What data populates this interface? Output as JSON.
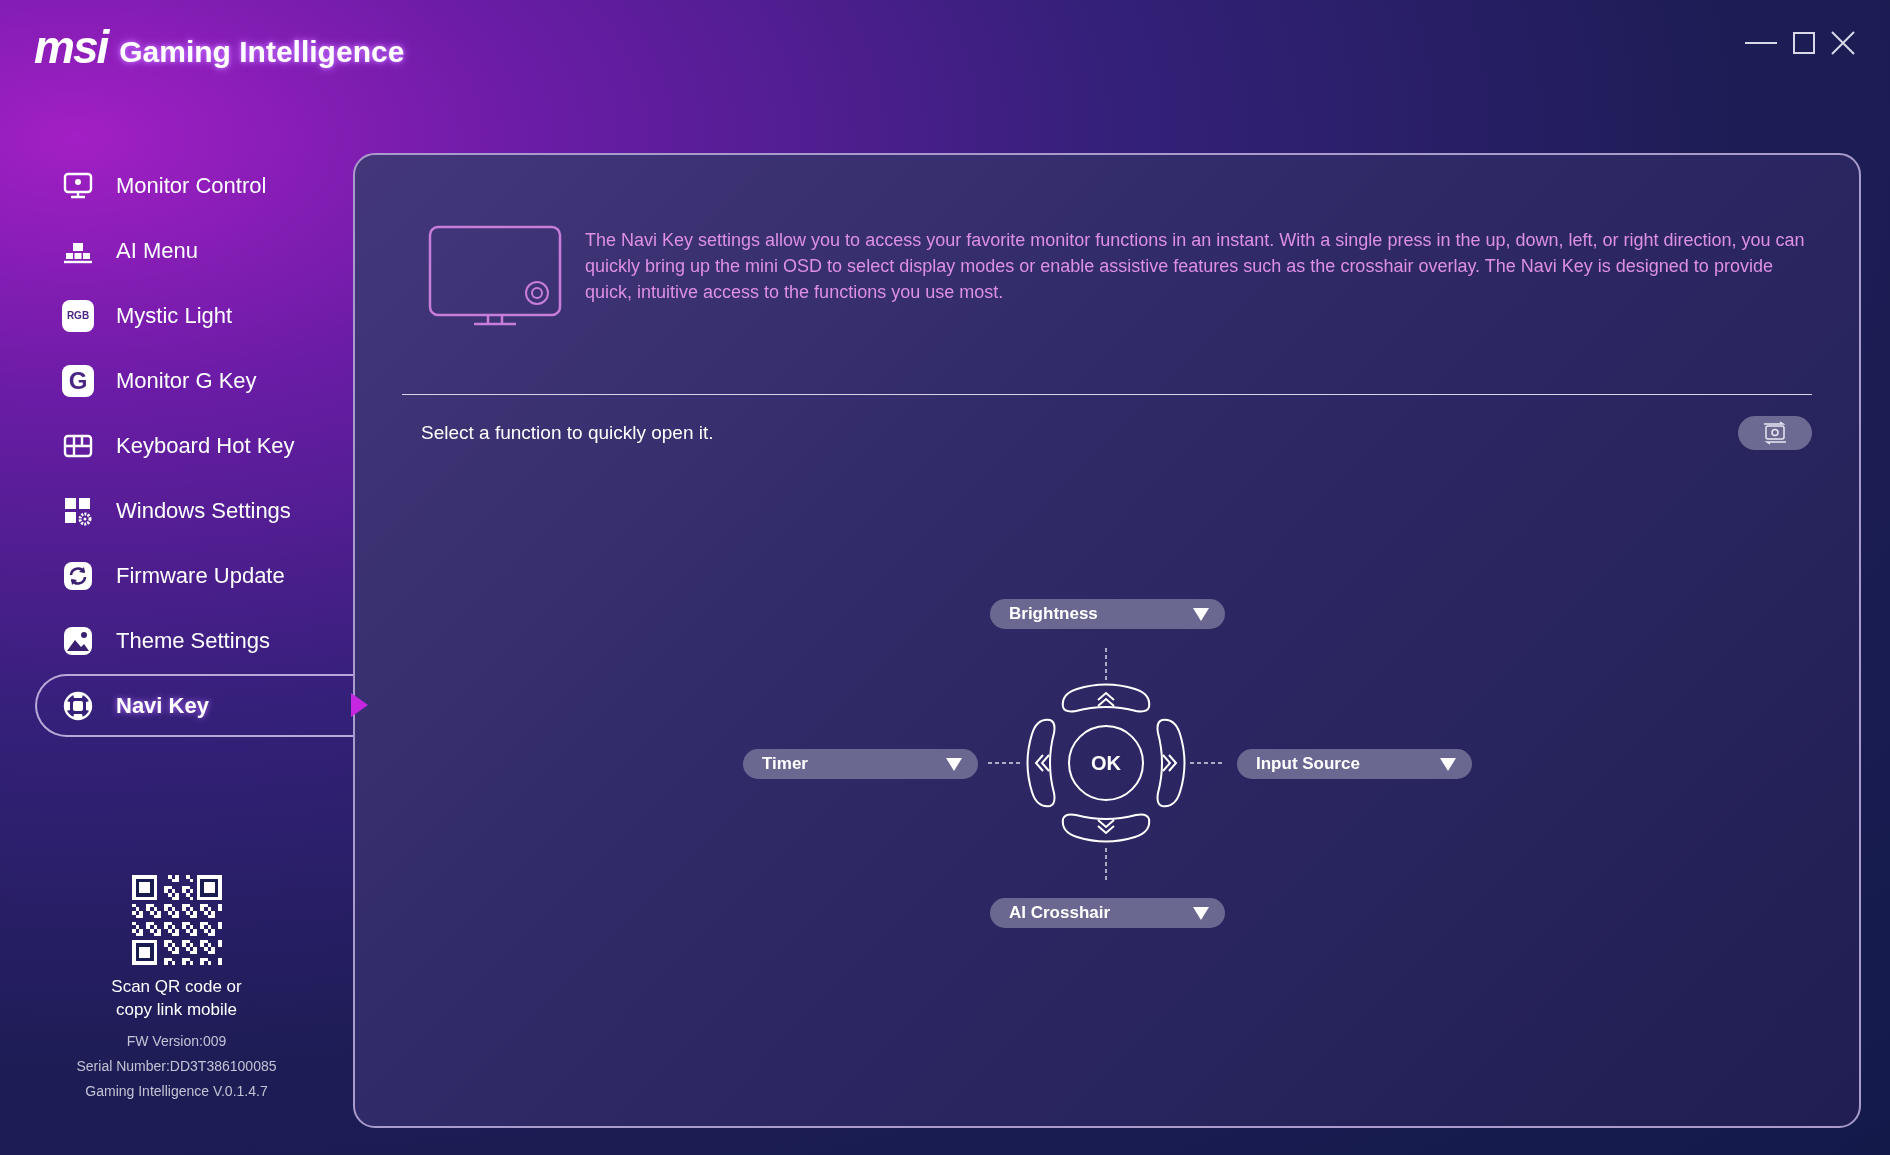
{
  "app": {
    "brand": "msi",
    "title": "Gaming Intelligence"
  },
  "sidebar": {
    "items": [
      {
        "label": "Monitor Control",
        "selected": false
      },
      {
        "label": "AI Menu",
        "selected": false
      },
      {
        "label": "Mystic Light",
        "selected": false,
        "icon_text": "RGB"
      },
      {
        "label": "Monitor G Key",
        "selected": false,
        "icon_text": "G"
      },
      {
        "label": "Keyboard Hot Key",
        "selected": false
      },
      {
        "label": "Windows Settings",
        "selected": false
      },
      {
        "label": "Firmware Update",
        "selected": false
      },
      {
        "label": "Theme Settings",
        "selected": false
      },
      {
        "label": "Navi Key",
        "selected": true
      }
    ],
    "qr_caption": [
      "Scan QR code or",
      "copy link mobile"
    ],
    "info": [
      "FW Version:009",
      "Serial Number:DD3T386100085",
      "Gaming Intelligence V.0.1.4.7"
    ]
  },
  "panel": {
    "description": "The Navi Key settings allow you to access your favorite monitor functions in an instant. With a single press in the up, down, left, or right direction, you can quickly bring up the mini OSD to select display modes or enable assistive features such as the crosshair overlay. The Navi Key is designed to provide quick, intuitive access to the functions you use most.",
    "prompt": "Select a function to quickly open it.",
    "navi": {
      "up": "Brightness",
      "left": "Timer",
      "right": "Input Source",
      "down": "AI Crosshair",
      "center": "OK"
    }
  }
}
